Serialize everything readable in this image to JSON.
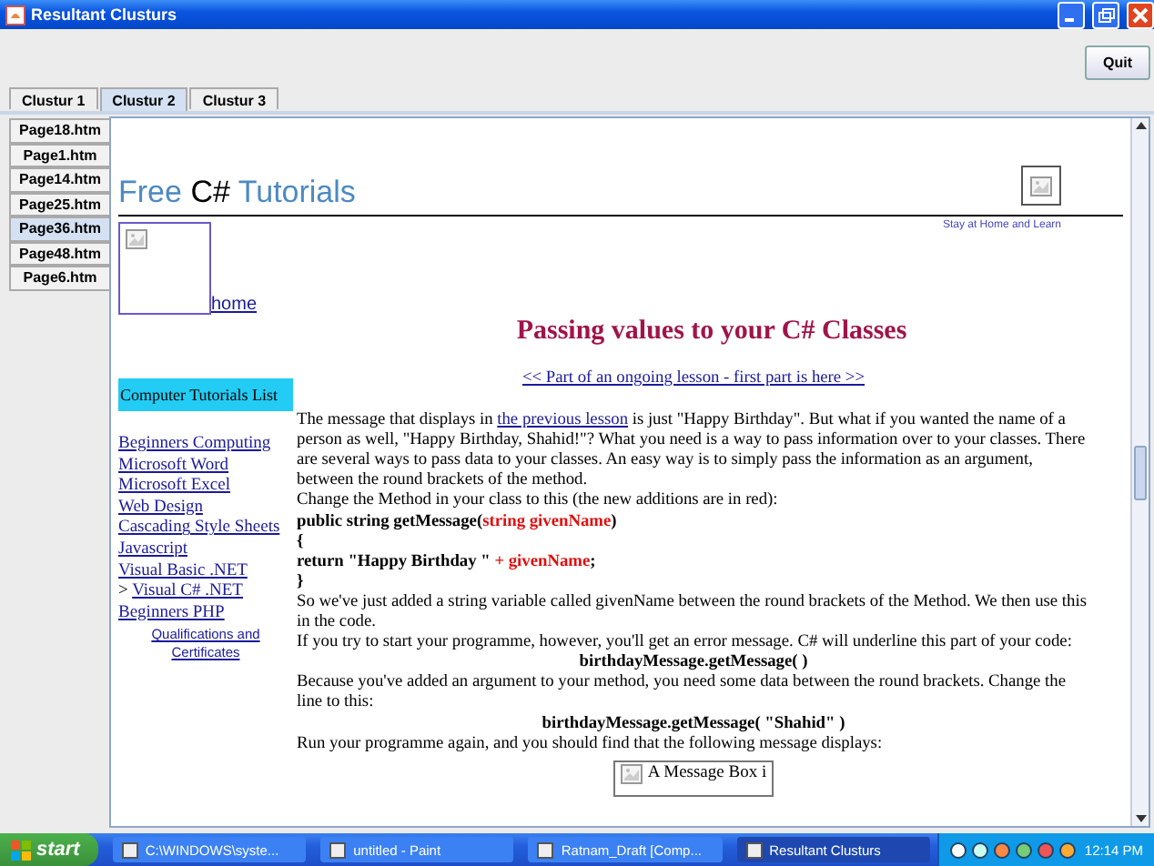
{
  "window": {
    "title": "Resultant Clusturs"
  },
  "toolbar": {
    "quit_button": "Quit"
  },
  "cluster_tabs": [
    {
      "label": "Clustur 1",
      "selected": false
    },
    {
      "label": "Clustur 2",
      "selected": true
    },
    {
      "label": "Clustur 3",
      "selected": false
    }
  ],
  "page_tabs": [
    {
      "label": "Page18.htm",
      "selected": false
    },
    {
      "label": "Page1.htm",
      "selected": false
    },
    {
      "label": "Page14.htm",
      "selected": false
    },
    {
      "label": "Page25.htm",
      "selected": false
    },
    {
      "label": "Page36.htm",
      "selected": true
    },
    {
      "label": "Page48.htm",
      "selected": false
    },
    {
      "label": "Page6.htm",
      "selected": false
    }
  ],
  "web_page": {
    "logo": [
      {
        "kind": "accent",
        "text": "Free"
      },
      {
        "kind": "plain",
        "text": "C#"
      },
      {
        "kind": "accent",
        "text": "Tutorials"
      }
    ],
    "tagline": "Stay at Home and Learn",
    "home_link": "home",
    "heading": "Passing values to your C# Classes",
    "lesson_link": "<< Part of an ongoing lesson - first part is here >>",
    "sidebar": {
      "title": "Computer Tutorials List",
      "items": [
        {
          "kind": "link",
          "label": "Beginners Computing "
        },
        {
          "kind": "link",
          "label": "Microsoft Word"
        },
        {
          "kind": "link",
          "label": "Microsoft Excel"
        },
        {
          "kind": "link",
          "label": "Web Design"
        },
        {
          "kind": "link",
          "label": "Cascading Style Sheets"
        },
        {
          "kind": "link",
          "label": "Javascript"
        },
        {
          "kind": "link",
          "label": "Visual Basic .NET"
        },
        {
          "kind": "current",
          "prefix": ">",
          "label": "Visual C# .NET"
        },
        {
          "kind": "link",
          "label": "Beginners PHP"
        },
        {
          "kind": "sub",
          "label": "Qualifications and Certificates "
        }
      ]
    },
    "blocks": [
      {
        "kind": "text",
        "parts": [
          {
            "kind": "plain",
            "text": "The message that displays in "
          },
          {
            "kind": "link",
            "text": "the previous lesson"
          },
          {
            "kind": "plain",
            "text": " is just \"Happy Birthday\". But what if you wanted the name of a person as well, \"Happy Birthday, Shahid!\"? What you need is a way to pass information over to your classes. There are several ways to pass data to your classes. An easy way is to simply pass the information as an argument, between the round brackets of the method."
          }
        ]
      },
      {
        "kind": "text",
        "parts": [
          {
            "kind": "plain",
            "text": "Change the Method in your class to this (the new additions are in red):"
          }
        ]
      },
      {
        "kind": "code",
        "parts": [
          {
            "kind": "plain",
            "text": "public string getMessage("
          },
          {
            "kind": "red",
            "text": "string givenName"
          },
          {
            "kind": "plain",
            "text": ")"
          }
        ]
      },
      {
        "kind": "code",
        "parts": [
          {
            "kind": "plain",
            "text": "{"
          }
        ]
      },
      {
        "kind": "code",
        "parts": [
          {
            "kind": "plain",
            "text": "return \"Happy Birthday \" "
          },
          {
            "kind": "red",
            "text": "+ givenName"
          },
          {
            "kind": "plain",
            "text": ";"
          }
        ]
      },
      {
        "kind": "code",
        "parts": [
          {
            "kind": "plain",
            "text": "}"
          }
        ]
      },
      {
        "kind": "text",
        "parts": [
          {
            "kind": "plain",
            "text": "So we've just added a string variable called givenName between the round brackets of the Method. We then use this in the code."
          }
        ]
      },
      {
        "kind": "text",
        "parts": [
          {
            "kind": "plain",
            "text": "If you try to start your programme, however, you'll get an error message. C# will underline this part of your code:"
          }
        ]
      },
      {
        "kind": "centered",
        "parts": [
          {
            "kind": "plain",
            "text": "birthdayMessage.getMessage( )"
          }
        ]
      },
      {
        "kind": "text",
        "parts": [
          {
            "kind": "plain",
            "text": "Because you've added an argument to your method, you need some data between the round brackets. Change the line to this:"
          }
        ]
      },
      {
        "kind": "centered",
        "parts": [
          {
            "kind": "plain",
            "text": "birthdayMessage.getMessage( \"Shahid\" )"
          }
        ]
      },
      {
        "kind": "text",
        "parts": [
          {
            "kind": "plain",
            "text": "Run your programme again, and you should find that the following message displays:"
          }
        ]
      }
    ],
    "image_caption": "A Message Box i"
  },
  "taskbar": {
    "start": "start",
    "tasks": [
      {
        "label": "C:\\WINDOWS\\syste...",
        "selected": false
      },
      {
        "label": "untitled - Paint",
        "selected": false
      },
      {
        "label": "Ratnam_Draft [Comp...",
        "selected": false
      },
      {
        "label": "Resultant Clusturs",
        "selected": true
      }
    ],
    "clock": "12:14 PM"
  }
}
